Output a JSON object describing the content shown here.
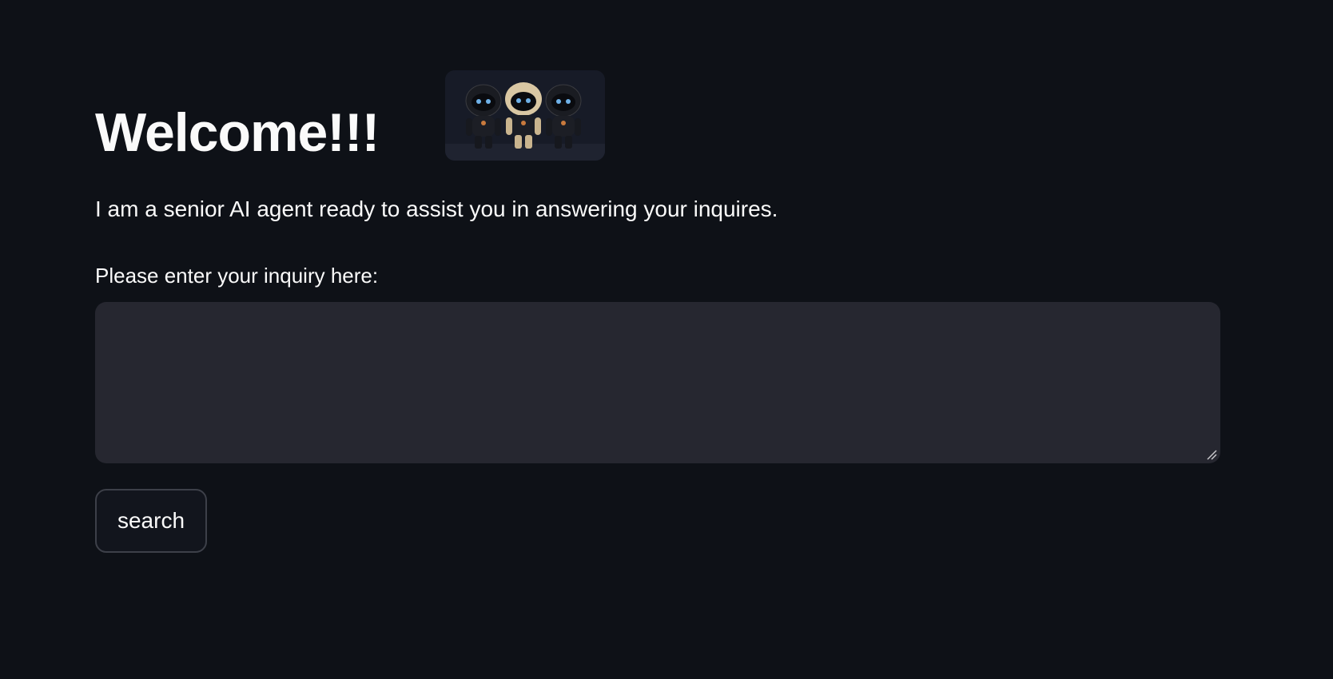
{
  "header": {
    "title": "Welcome!!!",
    "logo": "robots-image"
  },
  "intro": {
    "text": "I am a senior AI agent ready to assist you in answering your inquires."
  },
  "inquiry": {
    "label": "Please enter your inquiry here:",
    "value": "",
    "placeholder": ""
  },
  "actions": {
    "search_label": "search"
  },
  "colors": {
    "background": "#0e1117",
    "text": "#fafafa",
    "input_background": "#262730",
    "button_border": "#3d4049"
  }
}
